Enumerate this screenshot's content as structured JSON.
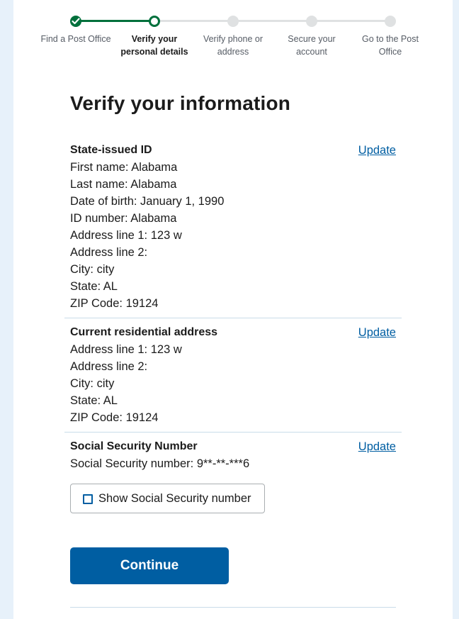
{
  "step_indicator": {
    "steps": [
      {
        "label": "Find a Post Office",
        "status": "complete"
      },
      {
        "label": "Verify your personal details",
        "status": "current"
      },
      {
        "label": "Verify phone or address",
        "status": "pending"
      },
      {
        "label": "Secure your account",
        "status": "pending"
      },
      {
        "label": "Go to the Post Office",
        "status": "pending"
      }
    ],
    "step_lines": {
      "line_1": "Find a Post Office",
      "line_2a": "Verify your",
      "line_2b": "personal details",
      "line_3a": "Verify phone or",
      "line_3b": "address",
      "line_4a": "Secure your",
      "line_4b": "account",
      "line_5a": "Go to the Post",
      "line_5b": "Office"
    }
  },
  "page_title": "Verify your information",
  "state_id": {
    "heading": "State-issued ID",
    "update_label": "Update",
    "lines": [
      "First name: Alabama",
      "Last name: Alabama",
      "Date of birth: January 1, 1990",
      "ID number: Alabama",
      "Address line 1: 123 w",
      "Address line 2:",
      "City: city",
      "State: AL",
      "ZIP Code: 19124"
    ]
  },
  "residential_address": {
    "heading": "Current residential address",
    "update_label": "Update",
    "lines": [
      "Address line 1: 123 w",
      "Address line 2:",
      "City: city",
      "State: AL",
      "ZIP Code: 19124"
    ]
  },
  "ssn": {
    "heading": "Social Security Number",
    "update_label": "Update",
    "value_line": "Social Security number: 9**-**-***6",
    "show_checkbox_label": "Show Social Security number",
    "show_checked": false
  },
  "continue_label": "Continue",
  "colors": {
    "accent": "#005ea2",
    "progress_green": "#00703c",
    "background": "#e7f1fa"
  }
}
